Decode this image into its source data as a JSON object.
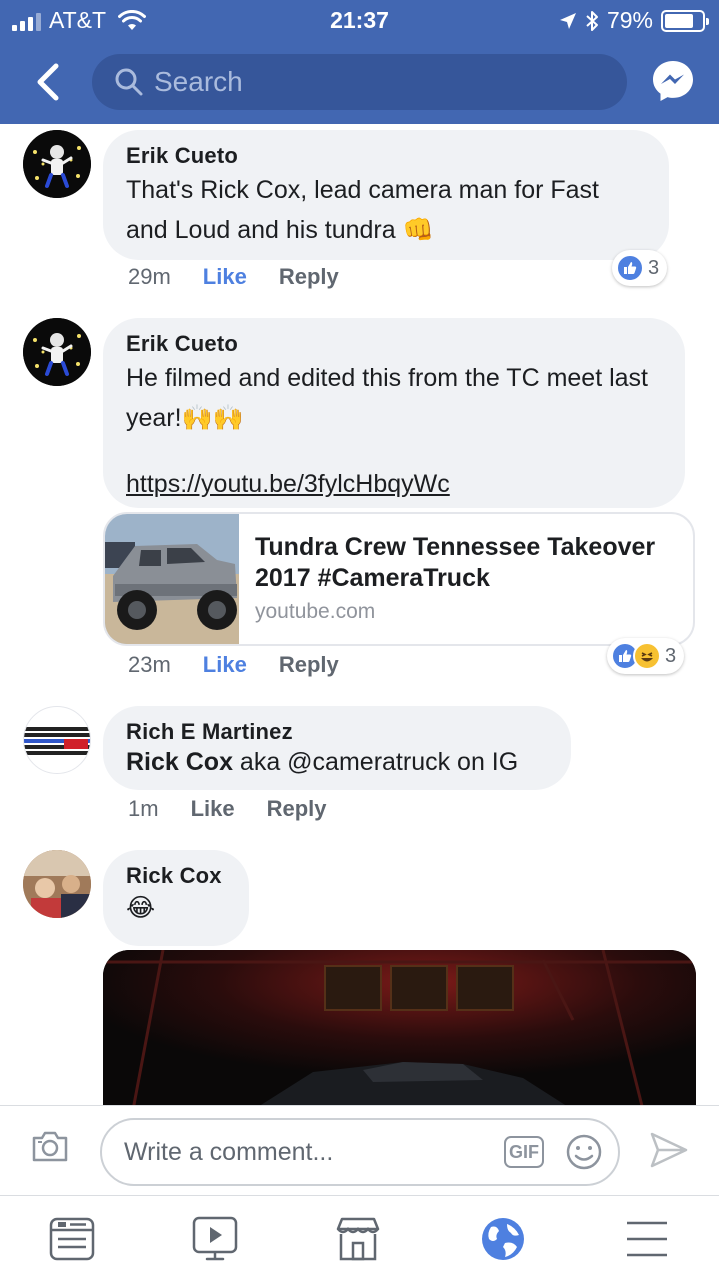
{
  "status_bar": {
    "carrier": "AT&T",
    "time": "21:37",
    "battery": "79%",
    "battery_level": 0.79
  },
  "header": {
    "search_placeholder": "Search"
  },
  "comments": [
    {
      "author": "Erik Cueto",
      "text": "That's Rick Cox, lead camera man for Fast and Loud and his tundra",
      "emoji": "👊",
      "time": "29m",
      "like_label": "Like",
      "reply_label": "Reply",
      "reaction_count": "3"
    },
    {
      "author": "Erik Cueto",
      "text": "He filmed and edited this from the TC meet last year!",
      "emoji": "🙌🙌",
      "link": "https://youtu.be/3fylcHbqyWc",
      "link_preview": {
        "title": "Tundra Crew Tennessee Takeover 2017 #CameraTruck",
        "domain": "youtube.com"
      },
      "time": "23m",
      "like_label": "Like",
      "reply_label": "Reply",
      "reaction_count": "3"
    },
    {
      "author": "Rich E Martinez",
      "mention": "Rick Cox",
      "text": " aka @cameratruck on IG",
      "time": "1m",
      "like_label": "Like",
      "reply_label": "Reply"
    },
    {
      "author": "Rick Cox",
      "emoji": "😂"
    }
  ],
  "composer": {
    "placeholder": "Write a comment...",
    "gif_label": "GIF"
  },
  "tabs": [
    "news-feed",
    "watch",
    "marketplace",
    "notifications",
    "menu"
  ],
  "colors": {
    "brand": "#4267b2",
    "like_blue": "#4e80e0",
    "bubble_bg": "#f0f2f5"
  }
}
